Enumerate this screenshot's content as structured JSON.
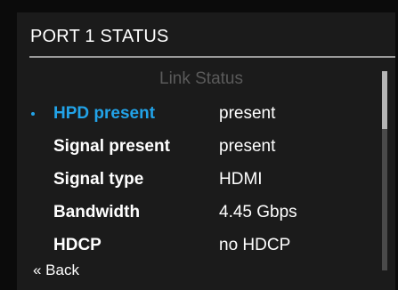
{
  "screen": {
    "title": "PORT 1 STATUS"
  },
  "section": {
    "header": "Link Status"
  },
  "rows": [
    {
      "label": "HPD present",
      "value": "present",
      "selected": true
    },
    {
      "label": "Signal present",
      "value": "present",
      "selected": false
    },
    {
      "label": "Signal type",
      "value": "HDMI",
      "selected": false
    },
    {
      "label": "Bandwidth",
      "value": "4.45 Gbps",
      "selected": false
    },
    {
      "label": "HDCP",
      "value": "no HDCP",
      "selected": false
    }
  ],
  "navigation": {
    "back_label": "« Back"
  },
  "scroll": {
    "visible_fraction": 0.29,
    "position_fraction": 0.0
  },
  "colors": {
    "accent": "#22a3e8",
    "background": "#1b1b1b",
    "text": "#ffffff",
    "muted_header": "#5a5a5a",
    "divider": "#9a9a9a"
  }
}
